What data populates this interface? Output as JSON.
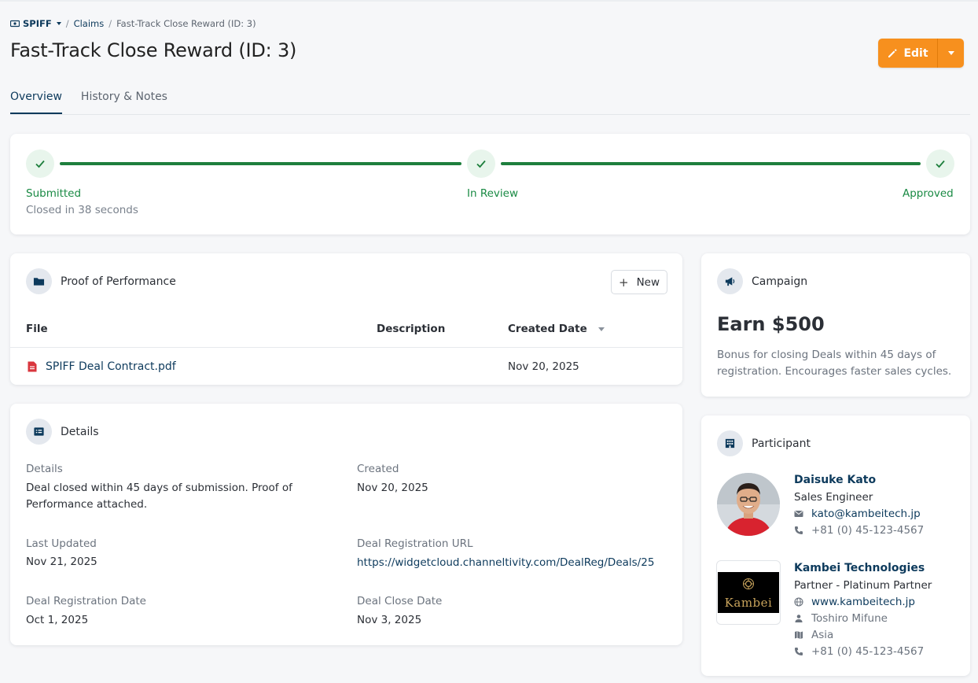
{
  "breadcrumb": {
    "root": "SPIFF",
    "claims": "Claims",
    "current": "Fast-Track Close Reward (ID: 3)"
  },
  "page": {
    "title": "Fast-Track Close Reward (ID: 3)"
  },
  "actions": {
    "edit_label": "Edit"
  },
  "tabs": [
    {
      "label": "Overview",
      "active": true
    },
    {
      "label": "History & Notes",
      "active": false
    }
  ],
  "progress": {
    "steps": [
      {
        "label": "Submitted",
        "sub": "Closed in 38 seconds"
      },
      {
        "label": "In Review"
      },
      {
        "label": "Approved"
      }
    ]
  },
  "proof": {
    "title": "Proof of Performance",
    "new_label": "New",
    "columns": {
      "file": "File",
      "description": "Description",
      "created": "Created Date"
    },
    "rows": [
      {
        "file": "SPIFF Deal Contract.pdf",
        "description": "",
        "created": "Nov 20, 2025"
      }
    ]
  },
  "details": {
    "title": "Details",
    "fields": {
      "details_label": "Details",
      "details_value": "Deal closed within 45 days of submission. Proof of Performance attached.",
      "created_label": "Created",
      "created_value": "Nov 20, 2025",
      "updated_label": "Last Updated",
      "updated_value": "Nov 21, 2025",
      "url_label": "Deal Registration URL",
      "url_value": "https://widgetcloud.channeltivity.com/DealReg/Deals/25",
      "reg_date_label": "Deal Registration Date",
      "reg_date_value": "Oct 1, 2025",
      "close_date_label": "Deal Close Date",
      "close_date_value": "Nov 3, 2025"
    }
  },
  "campaign": {
    "title": "Campaign",
    "headline": "Earn $500",
    "description": "Bonus for closing Deals within 45 days of registration. Encourages faster sales cycles."
  },
  "participant": {
    "title": "Participant",
    "person": {
      "name": "Daisuke Kato",
      "role": "Sales Engineer",
      "email": "kato@kambeitech.jp",
      "phone": "+81 (0) 45-123-4567"
    },
    "company": {
      "name": "Kambei Technologies",
      "tier": "Partner - Platinum Partner",
      "website": "www.kambeitech.jp",
      "contact": "Toshiro Mifune",
      "region": "Asia",
      "phone": "+81 (0) 45-123-4567",
      "logo_text": "Kambei"
    }
  },
  "colors": {
    "primary": "#0d3a5c",
    "accent": "#f7901e",
    "success": "#1e7f3d",
    "pdf": "#d9363e"
  }
}
